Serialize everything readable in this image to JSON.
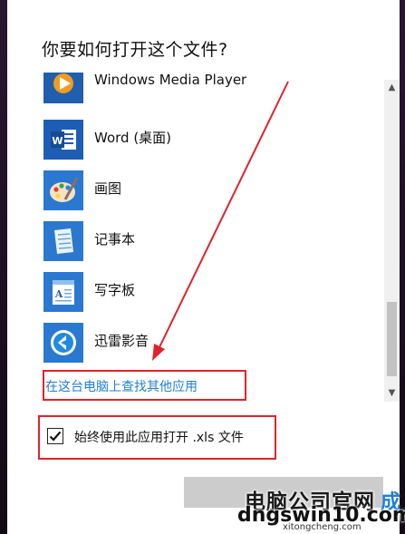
{
  "dialog": {
    "title": "你要如何打开这个文件?",
    "apps": [
      {
        "name": "Windows Media Player",
        "icon": "media-player-icon"
      },
      {
        "name": "Word (桌面)",
        "icon": "word-icon"
      },
      {
        "name": "画图",
        "icon": "paint-icon"
      },
      {
        "name": "记事本",
        "icon": "notepad-icon"
      },
      {
        "name": "写字板",
        "icon": "wordpad-icon"
      },
      {
        "name": "迅雷影音",
        "icon": "xunlei-player-icon"
      }
    ],
    "find_link": "在这台电脑上查找其他应用",
    "always_use": {
      "label": "始终使用此应用打开 .xls 文件",
      "checked": true
    },
    "annotation_color": "#e0232b",
    "link_color": "#1e7fd8"
  },
  "watermark": {
    "cn": "电脑公司官网",
    "en": "dngswin10.com",
    "sub": "xitongcheng.com",
    "char": "成"
  }
}
